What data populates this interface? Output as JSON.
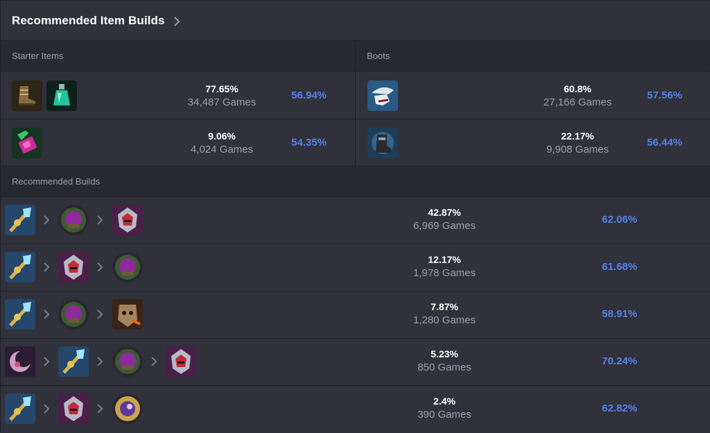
{
  "header": {
    "title": "Recommended Item Builds",
    "chevron_icon": "chevron-right-icon"
  },
  "starter": {
    "label": "Starter Items",
    "rows": [
      {
        "icons": [
          "boots-with-wrap-icon",
          "green-potion-icon"
        ],
        "pick": "77.65%",
        "games": "34,487 Games",
        "win": "56.94%"
      },
      {
        "icons": [
          "green-pink-flask-icon"
        ],
        "pick": "9.06%",
        "games": "4,024 Games",
        "win": "54.35%"
      }
    ]
  },
  "boots": {
    "label": "Boots",
    "rows": [
      {
        "icons": [
          "silver-winged-boots-icon"
        ],
        "pick": "60.8%",
        "games": "27,166 Games",
        "win": "57.56%"
      },
      {
        "icons": [
          "dark-armored-boots-icon"
        ],
        "pick": "22.17%",
        "games": "9,908 Games",
        "win": "56.44%"
      }
    ]
  },
  "builds": {
    "label": "Recommended Builds",
    "rows": [
      {
        "icons": [
          "blue-gold-staff-icon",
          "purple-orb-icon",
          "red-purple-helm-icon"
        ],
        "pick": "42.87%",
        "games": "6,969 Games",
        "win": "62.06%"
      },
      {
        "icons": [
          "blue-gold-staff-icon",
          "red-purple-helm-icon",
          "purple-orb-icon"
        ],
        "pick": "12.17%",
        "games": "1,978 Games",
        "win": "61.68%"
      },
      {
        "icons": [
          "blue-gold-staff-icon",
          "purple-orb-icon",
          "scarecrow-mask-icon"
        ],
        "pick": "7.87%",
        "games": "1,280 Games",
        "win": "58.91%"
      },
      {
        "icons": [
          "purple-crescent-icon",
          "blue-gold-staff-icon",
          "purple-orb-icon",
          "red-purple-helm-icon"
        ],
        "pick": "5.23%",
        "games": "850 Games",
        "win": "70.24%"
      },
      {
        "icons": [
          "blue-gold-staff-icon",
          "red-purple-helm-icon",
          "arcane-orb-icon"
        ],
        "pick": "2.4%",
        "games": "390 Games",
        "win": "62.82%"
      }
    ]
  },
  "colors": {
    "background": "#31313c",
    "subheader": "#282830",
    "winrate": "#5383e8",
    "muted": "#9e9eb1"
  }
}
